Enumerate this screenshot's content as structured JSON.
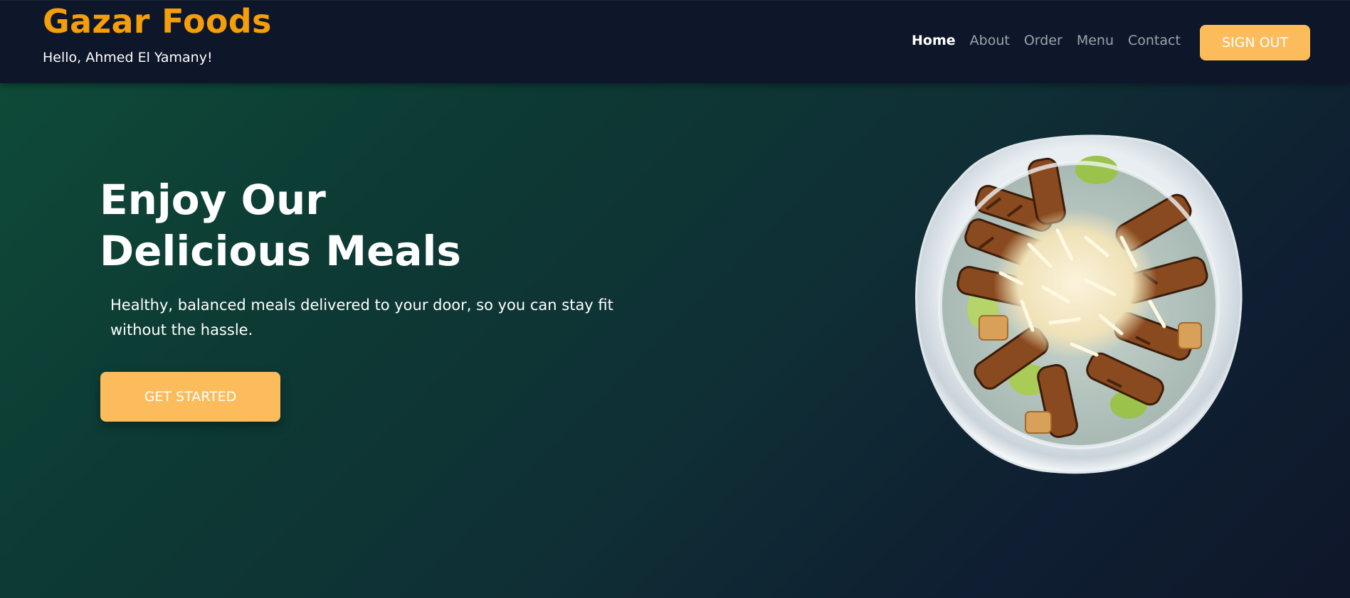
{
  "header": {
    "brand": "Gazar Foods",
    "greeting": "Hello, Ahmed El Yamany!",
    "nav": {
      "home": "Home",
      "about": "About",
      "order": "Order",
      "menu": "Menu",
      "contact": "Contact"
    },
    "signout_label": "SIGN OUT"
  },
  "hero": {
    "title_line1": "Enjoy Our",
    "title_line2": "Delicious Meals",
    "subtitle": "Healthy, balanced meals delivered to your door, so you can stay fit without the hassle.",
    "cta_label": "GET STARTED"
  },
  "colors": {
    "brand": "#f59e0b",
    "button": "#fcbc5c",
    "header_bg": "#0e1629",
    "hero_gradient_start": "#0e4a38",
    "hero_gradient_end": "#0f172a"
  }
}
